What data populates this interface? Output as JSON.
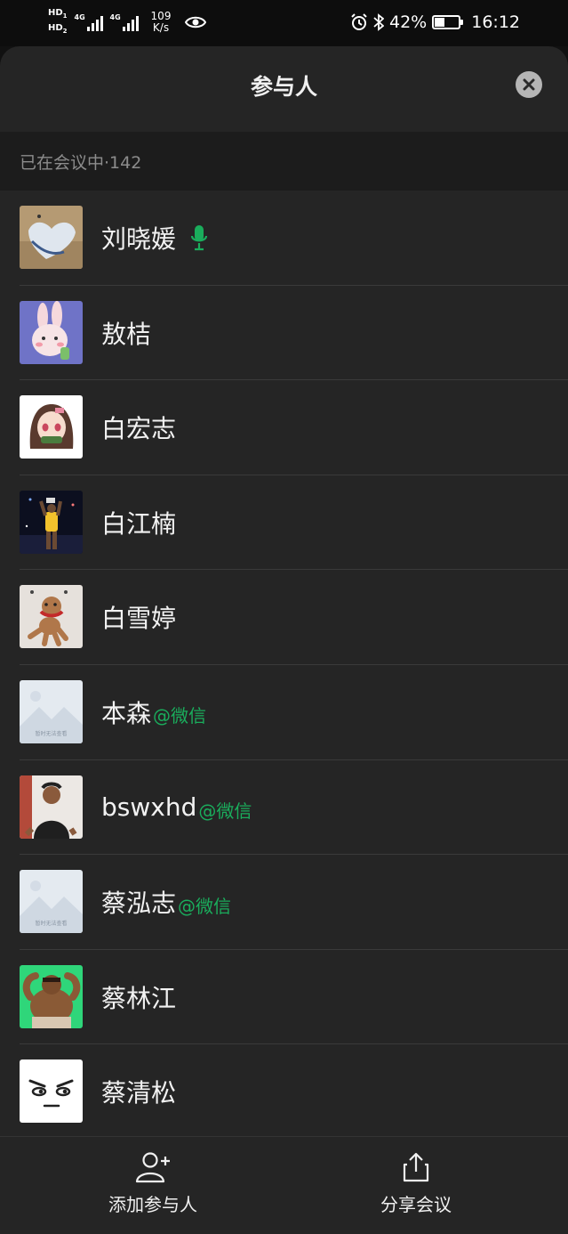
{
  "status_bar": {
    "hd1": "HD",
    "hd1_sub": "1",
    "hd2": "HD",
    "hd2_sub": "2",
    "sim1_net": "4G",
    "sim2_net": "4G",
    "net_speed_value": "109",
    "net_speed_unit": "K/s",
    "battery_percent": "42%",
    "battery_level": 0.42,
    "time": "16:12"
  },
  "sheet": {
    "title": "参与人",
    "section_label": "已在会议中·142"
  },
  "participants": [
    {
      "name": "刘晓媛",
      "suffix": "",
      "speaking": true,
      "avatar": "heart-sand"
    },
    {
      "name": "敖桔",
      "suffix": "",
      "speaking": false,
      "avatar": "bunny"
    },
    {
      "name": "白宏志",
      "suffix": "",
      "speaking": false,
      "avatar": "anime-girl"
    },
    {
      "name": "白江楠",
      "suffix": "",
      "speaking": false,
      "avatar": "basketball"
    },
    {
      "name": "白雪婷",
      "suffix": "",
      "speaking": false,
      "avatar": "poodle"
    },
    {
      "name": "本森",
      "suffix": "@微信",
      "speaking": false,
      "avatar": "placeholder"
    },
    {
      "name": "bswxhd",
      "suffix": "@微信",
      "speaking": false,
      "avatar": "man-photo"
    },
    {
      "name": "蔡泓志",
      "suffix": "@微信",
      "speaking": false,
      "avatar": "placeholder"
    },
    {
      "name": "蔡林江",
      "suffix": "",
      "speaking": false,
      "avatar": "muscle-cartoon"
    },
    {
      "name": "蔡清松",
      "suffix": "",
      "speaking": false,
      "avatar": "face-drawing"
    }
  ],
  "placeholder_text": "暂时无法查看",
  "actions": {
    "add_label": "添加参与人",
    "share_label": "分享会议"
  },
  "colors": {
    "accent_green": "#1aad5c",
    "sheet_bg": "#252525",
    "section_bg": "#1c1c1c"
  }
}
